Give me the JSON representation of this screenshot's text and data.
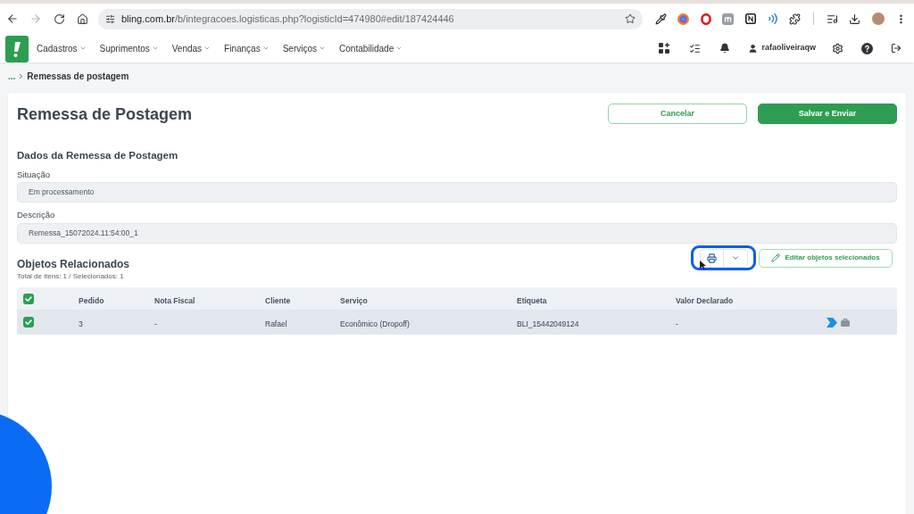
{
  "browser": {
    "url_host": "bling.com.br",
    "url_path": "/b/integracoes.logisticas.php?logisticId=474980#edit/187424446"
  },
  "app_header": {
    "menu": [
      {
        "label": "Cadastros"
      },
      {
        "label": "Suprimentos"
      },
      {
        "label": "Vendas"
      },
      {
        "label": "Finanças"
      },
      {
        "label": "Serviços"
      },
      {
        "label": "Contabilidade"
      }
    ],
    "user": "rafaoliveiraqw"
  },
  "breadcrumb": {
    "parent": "...",
    "current": "Remessas de postagem"
  },
  "page": {
    "title": "Remessa de Postagem",
    "buttons": [
      {
        "label": "Cancelar",
        "kind": "outline"
      },
      {
        "label": "Salvar e Enviar",
        "kind": "primary"
      }
    ]
  },
  "details": {
    "title": "Dados da Remessa de Postagem",
    "fields": [
      {
        "label": "Situação",
        "value": "Em processamento"
      },
      {
        "label": "Descrição",
        "value": "Remessa_15072024.11:54:00_1"
      }
    ]
  },
  "related": {
    "title": "Objetos Relacionados",
    "summary": "Total de itens: 1 / Selecionados: 1",
    "print_highlighted": true,
    "edit_button": "Editar objetos selecionados",
    "table": {
      "all_checked": true,
      "columns": [
        "Pedido",
        "Nota Fiscal",
        "Cliente",
        "Serviço",
        "Etiqueta",
        "Valor Declarado"
      ],
      "rows": [
        {
          "checked": true,
          "selected": true,
          "cells": [
            "3",
            "-",
            "Rafael",
            "Econômico (Dropoff)",
            "BLI_15442049124",
            "-"
          ]
        }
      ]
    }
  }
}
